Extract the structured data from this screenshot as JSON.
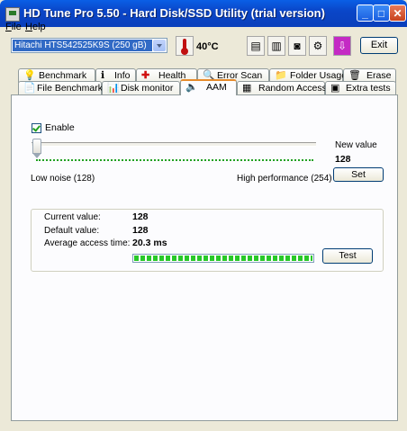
{
  "window": {
    "title": "HD Tune Pro 5.50 - Hard Disk/SSD Utility (trial version)"
  },
  "menu": [
    {
      "label": "File",
      "accel": "F",
      "rest": "ile"
    },
    {
      "label": "Help",
      "accel": "H",
      "rest": "elp"
    }
  ],
  "toolbar": {
    "drive": "Hitachi HTS542525K9S (250 gB)",
    "temperature": "40°C",
    "exit_label": "Exit",
    "icons": [
      "copy-text-icon",
      "copy-info-icon",
      "screenshot-icon",
      "options-icon",
      "save-icon"
    ]
  },
  "tabs_row1": [
    {
      "label": "Benchmark",
      "icon": "bulb-icon"
    },
    {
      "label": "Info",
      "icon": "info-icon"
    },
    {
      "label": "Health",
      "icon": "health-icon"
    },
    {
      "label": "Error Scan",
      "icon": "magnifier-icon"
    },
    {
      "label": "Folder Usage",
      "icon": "folder-icon"
    },
    {
      "label": "Erase",
      "icon": "trash-icon"
    }
  ],
  "tabs_row2": [
    {
      "label": "File Benchmark",
      "icon": "file-icon"
    },
    {
      "label": "Disk monitor",
      "icon": "chart-icon"
    },
    {
      "label": "AAM",
      "icon": "speaker-icon",
      "active": true
    },
    {
      "label": "Random Access",
      "icon": "random-icon"
    },
    {
      "label": "Extra tests",
      "icon": "tests-icon"
    }
  ],
  "aam": {
    "enable_label": "Enable",
    "enabled": true,
    "new_value_label": "New value",
    "new_value": "128",
    "set_label": "Set",
    "low_label": "Low noise (128)",
    "high_label": "High performance (254)",
    "slider_level": 0,
    "current_label": "Current value:",
    "current_value": "128",
    "default_label": "Default value:",
    "default_value": "128",
    "access_label": "Average access time:",
    "access_value": "20.3 ms",
    "progress": 1.0,
    "test_label": "Test"
  }
}
